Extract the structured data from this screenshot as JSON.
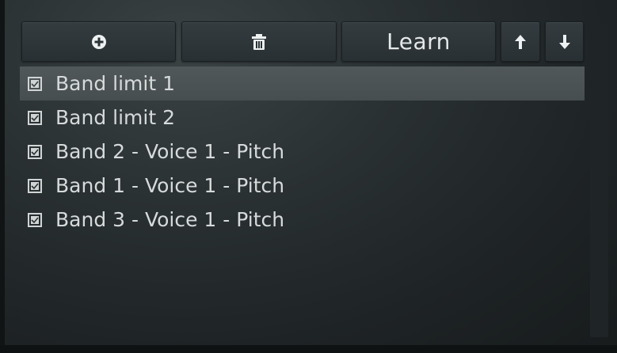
{
  "toolbar": {
    "add_icon": "plus-circle-icon",
    "delete_icon": "trash-icon",
    "learn_label": "Learn",
    "up_icon": "arrow-up-icon",
    "down_icon": "arrow-down-icon"
  },
  "list": {
    "items": [
      {
        "label": "Band limit 1",
        "checked": true,
        "selected": true
      },
      {
        "label": "Band limit 2",
        "checked": true,
        "selected": false
      },
      {
        "label": "Band 2 - Voice 1 - Pitch",
        "checked": true,
        "selected": false
      },
      {
        "label": "Band 1 - Voice 1 - Pitch",
        "checked": true,
        "selected": false
      },
      {
        "label": "Band 3 - Voice 1 - Pitch",
        "checked": true,
        "selected": false
      }
    ]
  },
  "colors": {
    "selected_row": "#4d5456",
    "text": "#d6dada",
    "button": "#30383b"
  }
}
